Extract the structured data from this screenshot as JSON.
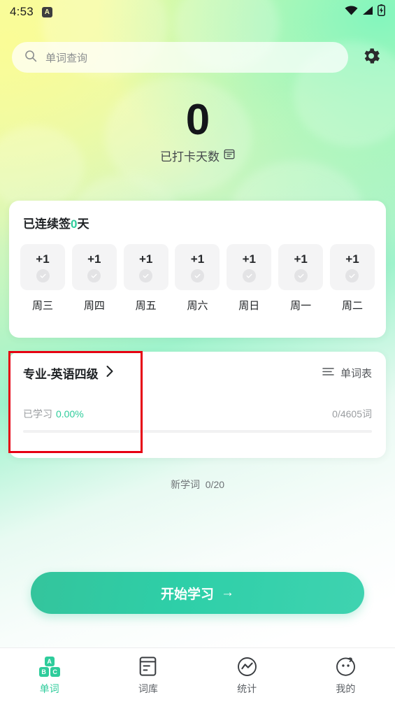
{
  "status_bar": {
    "time": "4:53",
    "badge_letter": "A",
    "icons": [
      "wifi-icon",
      "signal-icon",
      "battery-charging-icon"
    ]
  },
  "search": {
    "icon": "search-icon",
    "placeholder": "单词查询",
    "value": ""
  },
  "settings_button": {
    "icon": "gear-icon"
  },
  "hero": {
    "count": "0",
    "label": "已打卡天数",
    "icon": "calendar-icon"
  },
  "streak_card": {
    "title_prefix": "已连续签",
    "title_count": "0",
    "title_suffix": "天",
    "days": [
      {
        "bonus": "+1",
        "name": "周三",
        "checked": false
      },
      {
        "bonus": "+1",
        "name": "周四",
        "checked": false
      },
      {
        "bonus": "+1",
        "name": "周五",
        "checked": false
      },
      {
        "bonus": "+1",
        "name": "周六",
        "checked": false
      },
      {
        "bonus": "+1",
        "name": "周日",
        "checked": false
      },
      {
        "bonus": "+1",
        "name": "周一",
        "checked": false
      },
      {
        "bonus": "+1",
        "name": "周二",
        "checked": false
      }
    ]
  },
  "study_card": {
    "title": "专业-英语四级",
    "chevron_icon": "chevron-right-icon",
    "wordlist_icon": "list-icon",
    "wordlist_label": "单词表",
    "learned_label": "已学习",
    "learned_percent": "0.00%",
    "word_count": "0/4605词",
    "progress_percent": 0
  },
  "new_words": {
    "label": "新学词",
    "value": "0/20"
  },
  "start_button": {
    "label": "开始学习",
    "arrow": "→"
  },
  "bottom_nav": [
    {
      "label": "单词",
      "icon": "abc-blocks-icon",
      "active": true
    },
    {
      "label": "词库",
      "icon": "document-icon",
      "active": false
    },
    {
      "label": "统计",
      "icon": "chart-circle-icon",
      "active": false
    },
    {
      "label": "我的",
      "icon": "face-icon",
      "active": false
    }
  ],
  "colors": {
    "accent": "#2ecc9b",
    "gradient_start": "#f6fba6",
    "gradient_end": "#9ff3cc",
    "annotation": "#e60012",
    "text_primary": "#1f2225",
    "text_muted": "#9a9da0"
  }
}
